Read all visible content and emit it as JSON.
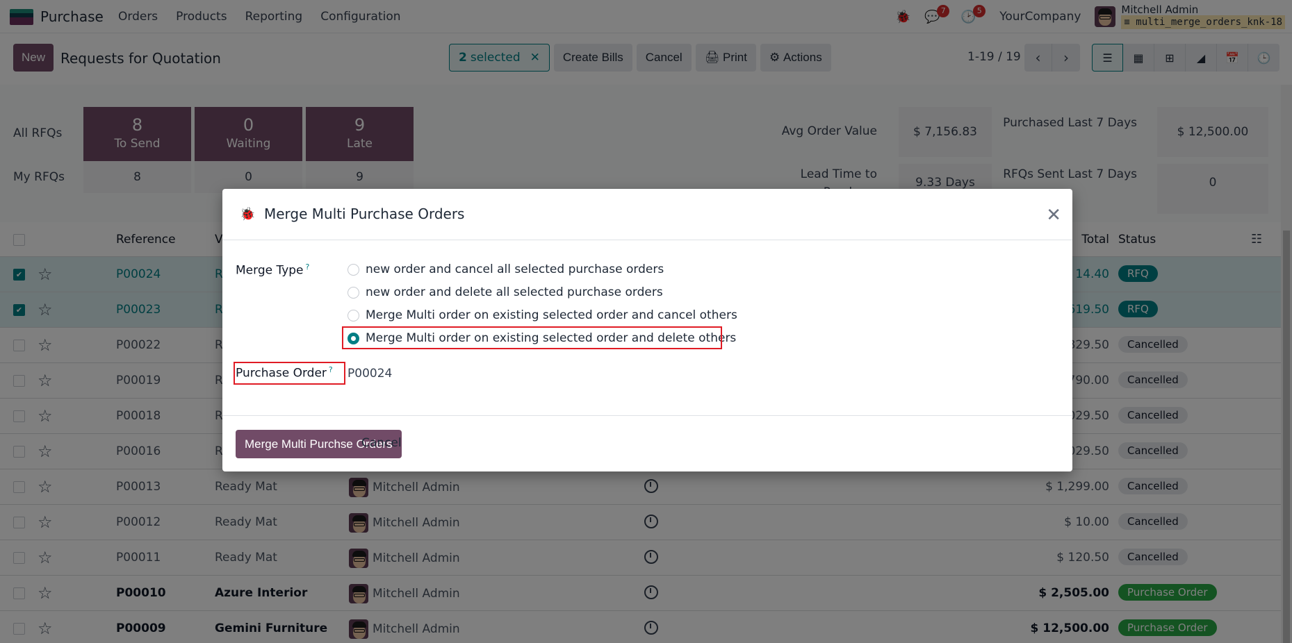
{
  "navbar": {
    "app_name": "Purchase",
    "menu": [
      "Orders",
      "Products",
      "Reporting",
      "Configuration"
    ],
    "icons": {
      "debug": "bug-icon",
      "messages": "chat-icon",
      "activities": "clock-icon"
    },
    "message_count": "7",
    "activity_count": "5",
    "company": "YourCompany",
    "user_name": "Mitchell Admin",
    "database": "multi_merge_orders_knk-18"
  },
  "control_panel": {
    "new_label": "New",
    "title": "Requests for Quotation",
    "selected_count": "2",
    "selected_label": "selected",
    "clear_selection": "✕",
    "create_bills": "Create Bills",
    "cancel": "Cancel",
    "print": "Print",
    "actions": "Actions",
    "pager": "1-19 / 19",
    "views": [
      "list",
      "kanban",
      "pivot",
      "graph",
      "calendar",
      "activity"
    ]
  },
  "dashboard": {
    "all_rfqs_label": "All RFQs",
    "my_rfqs_label": "My RFQs",
    "tiles": [
      {
        "value": "8",
        "label": "To Send",
        "mine": "8"
      },
      {
        "value": "0",
        "label": "Waiting",
        "mine": "0"
      },
      {
        "value": "9",
        "label": "Late",
        "mine": "9"
      }
    ],
    "kpis": {
      "avg_order_value_label": "Avg Order Value",
      "avg_order_value": "$ 7,156.83",
      "purchased_last_7_label": "Purchased Last 7 Days",
      "purchased_last_7": "$ 12,500.00",
      "lead_time_label": "Lead Time to Purchase",
      "lead_time": "9.33 Days",
      "rfqs_sent_label": "RFQs Sent Last 7 Days",
      "rfqs_sent": "0"
    }
  },
  "table": {
    "columns": {
      "reference": "Reference",
      "vendor": "V",
      "total": "Total",
      "status": "Status"
    },
    "rows": [
      {
        "ref": "P00024",
        "vendor": "R",
        "buyer": "",
        "total": "$ 14.40",
        "status": "RFQ",
        "status_type": "rfq",
        "selected": true
      },
      {
        "ref": "P00023",
        "vendor": "R",
        "buyer": "",
        "total": "619.50",
        "status": "RFQ",
        "status_type": "rfq",
        "selected": true
      },
      {
        "ref": "P00022",
        "vendor": "R",
        "buyer": "",
        "total": "829.50",
        "status": "Cancelled",
        "status_type": "cancelled",
        "selected": false
      },
      {
        "ref": "P00019",
        "vendor": "R",
        "buyer": "",
        "total": "790.00",
        "status": "Cancelled",
        "status_type": "cancelled",
        "selected": false
      },
      {
        "ref": "P00018",
        "vendor": "R",
        "buyer": "",
        "total": "029.50",
        "status": "Cancelled",
        "status_type": "cancelled",
        "selected": false
      },
      {
        "ref": "P00016",
        "vendor": "R",
        "buyer": "",
        "total": "029.50",
        "status": "Cancelled",
        "status_type": "cancelled",
        "selected": false
      },
      {
        "ref": "P00013",
        "vendor": "Ready Mat",
        "buyer": "Mitchell Admin",
        "total": "$ 1,299.00",
        "status": "Cancelled",
        "status_type": "cancelled",
        "selected": false
      },
      {
        "ref": "P00012",
        "vendor": "Ready Mat",
        "buyer": "Mitchell Admin",
        "total": "$ 10.00",
        "status": "Cancelled",
        "status_type": "cancelled",
        "selected": false
      },
      {
        "ref": "P00011",
        "vendor": "Ready Mat",
        "buyer": "Mitchell Admin",
        "total": "$ 120.50",
        "status": "Cancelled",
        "status_type": "cancelled",
        "selected": false
      },
      {
        "ref": "P00010",
        "vendor": "Azure Interior",
        "buyer": "Mitchell Admin",
        "total": "$ 2,505.00",
        "status": "Purchase Order",
        "status_type": "po",
        "selected": false,
        "bold": true
      },
      {
        "ref": "P00009",
        "vendor": "Gemini Furniture",
        "buyer": "Mitchell Admin",
        "total": "$ 12,500.00",
        "status": "Purchase Order",
        "status_type": "po",
        "selected": false,
        "bold": true
      }
    ]
  },
  "modal": {
    "title": "Merge Multi Purchase Orders",
    "merge_type_label": "Merge Type",
    "help_mark": "?",
    "options": [
      {
        "label": "new order and cancel all selected purchase orders",
        "checked": false
      },
      {
        "label": "new order and delete all selected purchase orders",
        "checked": false
      },
      {
        "label": "Merge Multi order on existing selected order and cancel others",
        "checked": false
      },
      {
        "label": "Merge Multi order on existing selected order and delete others",
        "checked": true
      }
    ],
    "purchase_order_label": "Purchase Order",
    "purchase_order_value": "P00024",
    "confirm_label": "Merge Multi Purchse Orders",
    "cancel_label": "Cancel",
    "accent_color": "#017e84",
    "highlight_color": "#e01b24"
  }
}
